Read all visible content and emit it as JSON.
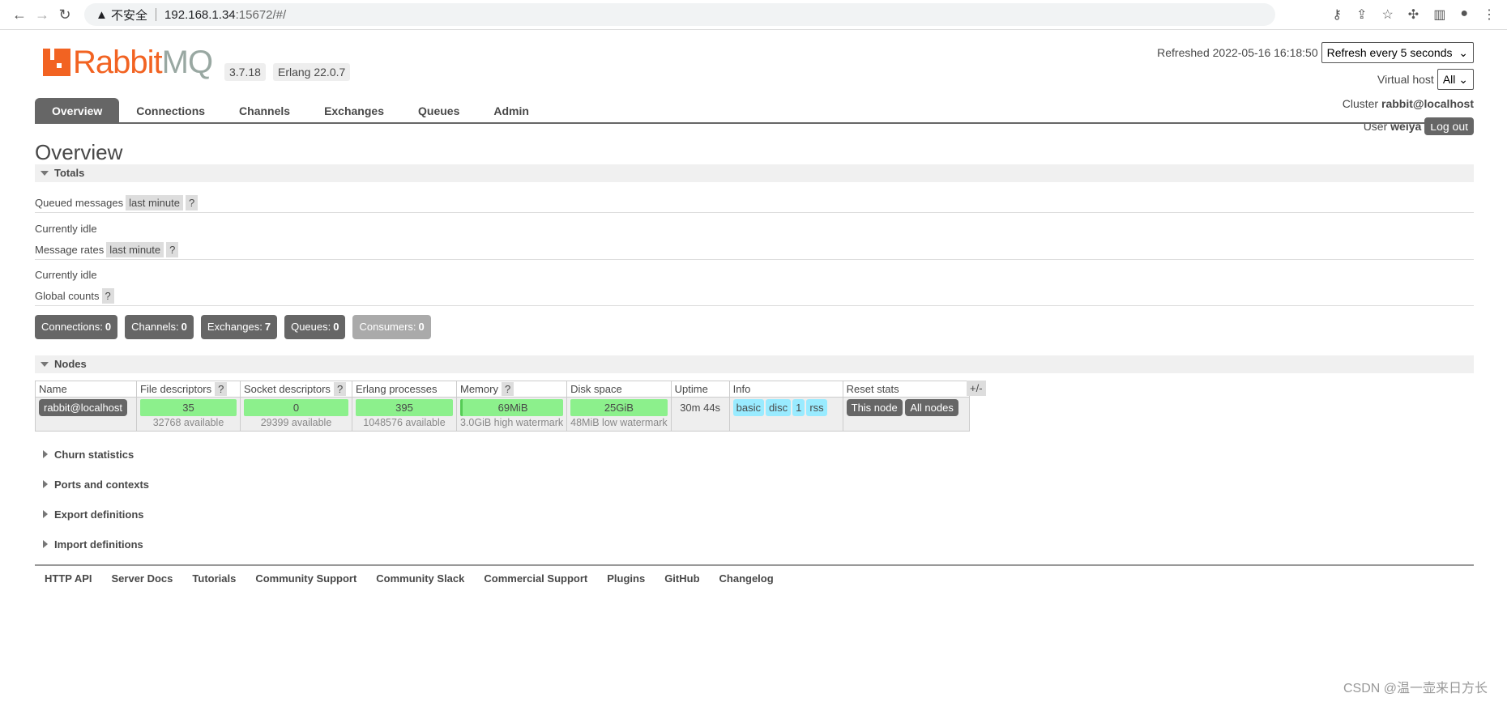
{
  "browser": {
    "security": "不安全",
    "url_host": "192.168.1.34",
    "url_rest": ":15672/#/"
  },
  "header": {
    "logo_a": "Rabbit",
    "logo_b": "MQ",
    "version": "3.7.18",
    "erlang": "Erlang 22.0.7",
    "refreshed": "Refreshed 2022-05-16 16:18:50",
    "refresh_select": "Refresh every 5 seconds",
    "vhost_label": "Virtual host",
    "vhost_value": "All",
    "cluster_label": "Cluster",
    "cluster": "rabbit@localhost",
    "user_label": "User",
    "user": "weiya",
    "logout": "Log out"
  },
  "tabs": [
    "Overview",
    "Connections",
    "Channels",
    "Exchanges",
    "Queues",
    "Admin"
  ],
  "title": "Overview",
  "totals": {
    "heading": "Totals",
    "queued": "Queued messages",
    "queued_range": "last minute",
    "help": "?",
    "idle1": "Currently idle",
    "rates": "Message rates",
    "rates_range": "last minute",
    "idle2": "Currently idle",
    "global": "Global counts"
  },
  "counts": [
    {
      "label": "Connections:",
      "value": "0"
    },
    {
      "label": "Channels:",
      "value": "0"
    },
    {
      "label": "Exchanges:",
      "value": "7"
    },
    {
      "label": "Queues:",
      "value": "0"
    },
    {
      "label": "Consumers:",
      "value": "0"
    }
  ],
  "nodes": {
    "heading": "Nodes",
    "columns": [
      "Name",
      "File descriptors",
      "Socket descriptors",
      "Erlang processes",
      "Memory",
      "Disk space",
      "Uptime",
      "Info",
      "Reset stats"
    ],
    "toggle": "+/-",
    "row": {
      "name": "rabbit@localhost",
      "fd": "35",
      "fd_sub": "32768 available",
      "sd": "0",
      "sd_sub": "29399 available",
      "ep": "395",
      "ep_sub": "1048576 available",
      "mem": "69MiB",
      "mem_sub": "3.0GiB high watermark",
      "disk": "25GiB",
      "disk_sub": "48MiB low watermark",
      "uptime": "30m 44s",
      "info": [
        "basic",
        "disc",
        "1",
        "rss"
      ],
      "reset_this": "This node",
      "reset_all": "All nodes"
    }
  },
  "sections": [
    "Churn statistics",
    "Ports and contexts",
    "Export definitions",
    "Import definitions"
  ],
  "footer": [
    "HTTP API",
    "Server Docs",
    "Tutorials",
    "Community Support",
    "Community Slack",
    "Commercial Support",
    "Plugins",
    "GitHub",
    "Changelog"
  ],
  "watermark": "CSDN @温一壶来日方长",
  "colors": {
    "brand": "#f26322",
    "ok_bar": "#8cf08c",
    "info_badge": "#99ebff"
  }
}
